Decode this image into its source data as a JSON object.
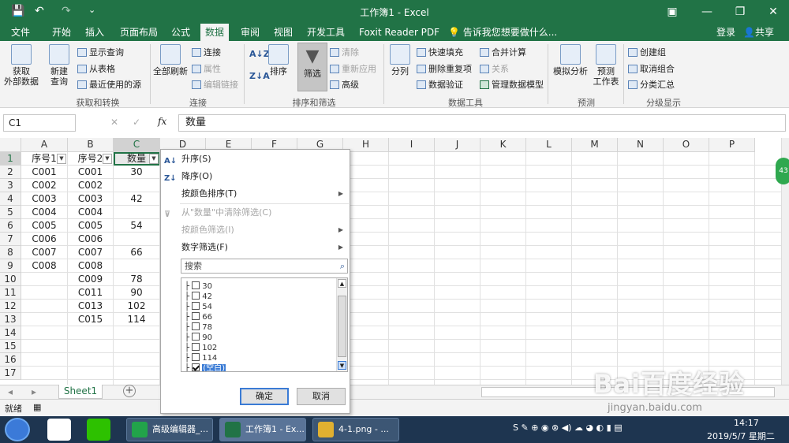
{
  "window": {
    "title": "工作簿1 - Excel",
    "min": "—",
    "restore": "❐",
    "close": "✕",
    "ribbon_opt": "▣",
    "undo": "↶",
    "redo": "↷",
    "save": "💾",
    "customize": "⌄"
  },
  "menu": {
    "tabs": [
      "文件",
      "开始",
      "插入",
      "页面布局",
      "公式",
      "数据",
      "审阅",
      "视图",
      "开发工具",
      "Foxit Reader PDF"
    ],
    "active": "数据",
    "tellme": "告诉我您想要做什么...",
    "login": "登录",
    "share": "共享"
  },
  "ribbon": {
    "get_external": "获取\n外部数据",
    "new_query": "新建\n查询",
    "show_query": "显示查询",
    "from_table": "从表格",
    "recent_sources": "最近使用的源",
    "group_get": "获取和转换",
    "refresh_all": "全部刷新",
    "connections": "连接",
    "properties": "属性",
    "edit_links": "编辑链接",
    "group_conn": "连接",
    "sort": "排序",
    "filter": "筛选",
    "clear": "清除",
    "reapply": "重新应用",
    "advanced": "高级",
    "group_sort": "排序和筛选",
    "text_to_col": "分列",
    "flash_fill": "快速填充",
    "remove_dup": "删除重复项",
    "validation": "数据验证",
    "consolidate": "合并计算",
    "relationships": "关系",
    "data_model": "管理数据模型",
    "group_tools": "数据工具",
    "what_if": "模拟分析",
    "forecast": "预测\n工作表",
    "group_forecast": "预测",
    "group_on": "创建组",
    "ungroup": "取消组合",
    "subtotal": "分类汇总",
    "group_outline": "分级显示"
  },
  "formula": {
    "namebox": "C1",
    "value": "数量",
    "fx": "fx",
    "cancel": "✕",
    "confirm": "✓"
  },
  "grid": {
    "columns": [
      "A",
      "B",
      "C",
      "D",
      "E",
      "F",
      "G",
      "H",
      "I",
      "J",
      "K",
      "L",
      "M",
      "N",
      "O",
      "P"
    ],
    "rows": [
      "1",
      "2",
      "3",
      "4",
      "5",
      "6",
      "7",
      "8",
      "9",
      "10",
      "11",
      "12",
      "13",
      "14",
      "15",
      "16",
      "17"
    ],
    "headers": {
      "A": "序号1",
      "B": "序号2",
      "C": "数量"
    },
    "colA": [
      "C001",
      "C002",
      "C003",
      "C004",
      "C005",
      "C006",
      "C007",
      "C008"
    ],
    "colB": [
      "C001",
      "C002",
      "C003",
      "C004",
      "C005",
      "C006",
      "C007",
      "C008",
      "C009",
      "C011",
      "C013",
      "C015"
    ],
    "colC": [
      "30",
      "",
      "42",
      "",
      "54",
      "",
      "66",
      "",
      "78",
      "90",
      "102",
      "114"
    ]
  },
  "sheet": {
    "tab": "Sheet1",
    "add": "+"
  },
  "status": {
    "ready": "就绪",
    "badge": "43"
  },
  "dropdown": {
    "sort_asc": "升序(S)",
    "sort_desc": "降序(O)",
    "sort_color": "按颜色排序(T)",
    "clear_filter": "从\"数量\"中清除筛选(C)",
    "filter_color": "按颜色筛选(I)",
    "number_filter": "数字筛选(F)",
    "search_placeholder": "搜索",
    "items": [
      {
        "label": "30",
        "checked": false
      },
      {
        "label": "42",
        "checked": false
      },
      {
        "label": "54",
        "checked": false
      },
      {
        "label": "66",
        "checked": false
      },
      {
        "label": "78",
        "checked": false
      },
      {
        "label": "90",
        "checked": false
      },
      {
        "label": "102",
        "checked": false
      },
      {
        "label": "114",
        "checked": false
      },
      {
        "label": "(空白)",
        "checked": true
      }
    ],
    "ok": "确定",
    "cancel": "取消"
  },
  "taskbar": {
    "apps": [
      "高级编辑器_...",
      "工作簿1 - Ex...",
      "4-1.png - ..."
    ],
    "time": "14:17",
    "date": "2019/5/7 星期二"
  },
  "watermark": {
    "brand": "Bai百度经验",
    "url": "jingyan.baidu.com"
  }
}
